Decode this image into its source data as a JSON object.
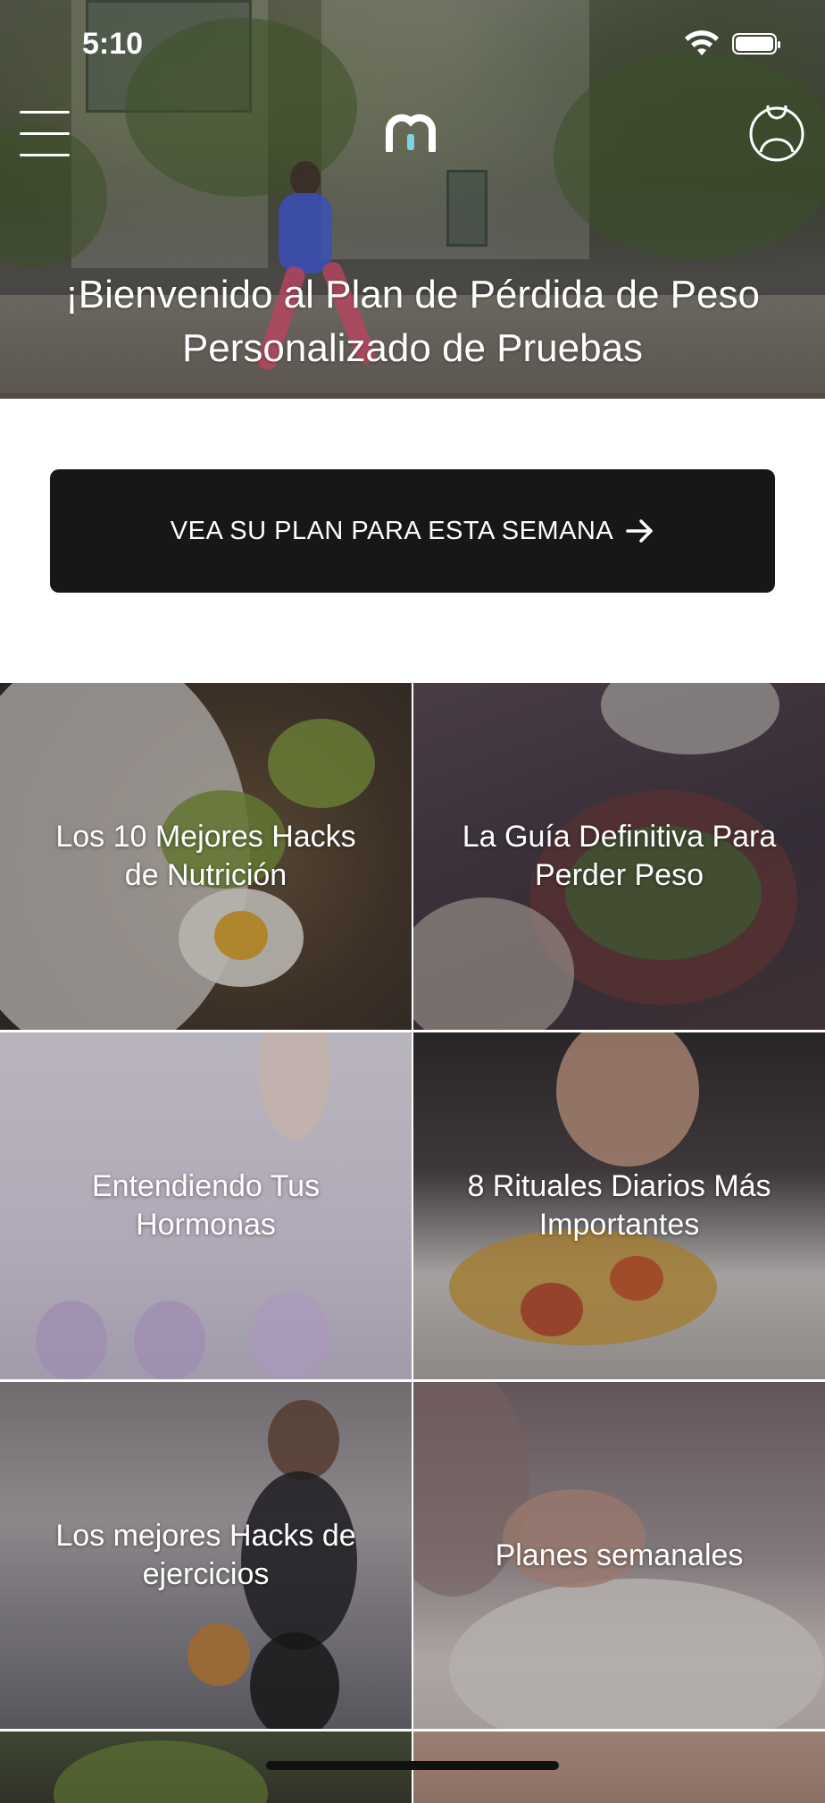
{
  "status_bar": {
    "time": "5:10"
  },
  "header": {
    "menu_icon": "hamburger-menu-icon",
    "logo_icon": "m-logo-icon",
    "profile_icon": "user-profile-icon",
    "title": "¡Bienvenido al Plan de Pérdida de Peso Personalizado de Pruebas"
  },
  "cta": {
    "label": "VEA SU PLAN PARA ESTA SEMANA",
    "icon": "arrow-right-icon"
  },
  "tiles": [
    {
      "label": "Los 10 Mejores Hacks de Nutrición"
    },
    {
      "label": "La Guía Definitiva Para Perder Peso"
    },
    {
      "label": "Entendiendo Tus Hormonas"
    },
    {
      "label": "8 Rituales Diarios Más Importantes"
    },
    {
      "label": "Los mejores Hacks de ejercicios"
    },
    {
      "label": "Planes semanales"
    }
  ],
  "colors": {
    "cta_background": "#171717",
    "logo_accent": "#7fd3e0"
  }
}
